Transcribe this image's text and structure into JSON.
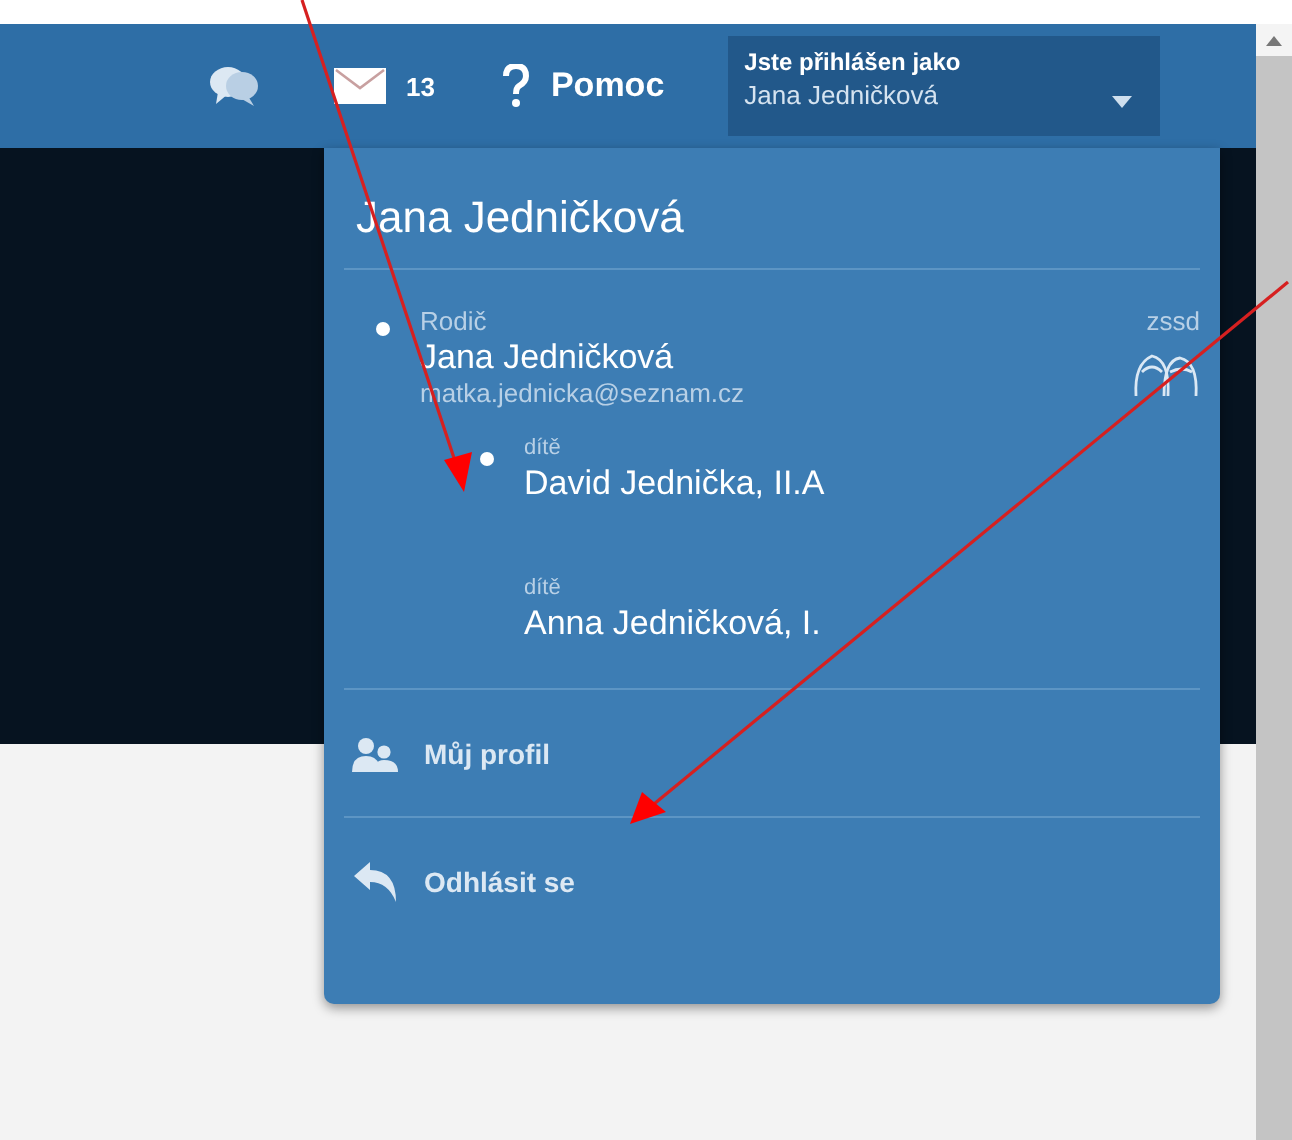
{
  "header": {
    "messages_count": "13",
    "help": "Pomoc",
    "login_label": "Jste přihlášen jako",
    "user_name": "Jana Jedničková"
  },
  "menu": {
    "title": "Jana Jedničková",
    "parent": {
      "role": "Rodič",
      "name": "Jana Jedničková",
      "email": "matka.jednicka@seznam.cz",
      "school": "zssd",
      "selected": true
    },
    "children": [
      {
        "role": "dítě",
        "name": "David Jednička, II.A",
        "selected": true
      },
      {
        "role": "dítě",
        "name": "Anna Jedničková, I.",
        "selected": false
      }
    ],
    "actions": [
      {
        "kind": "profile",
        "label": "Můj profil"
      },
      {
        "kind": "logout",
        "label": "Odhlásit se"
      }
    ]
  }
}
